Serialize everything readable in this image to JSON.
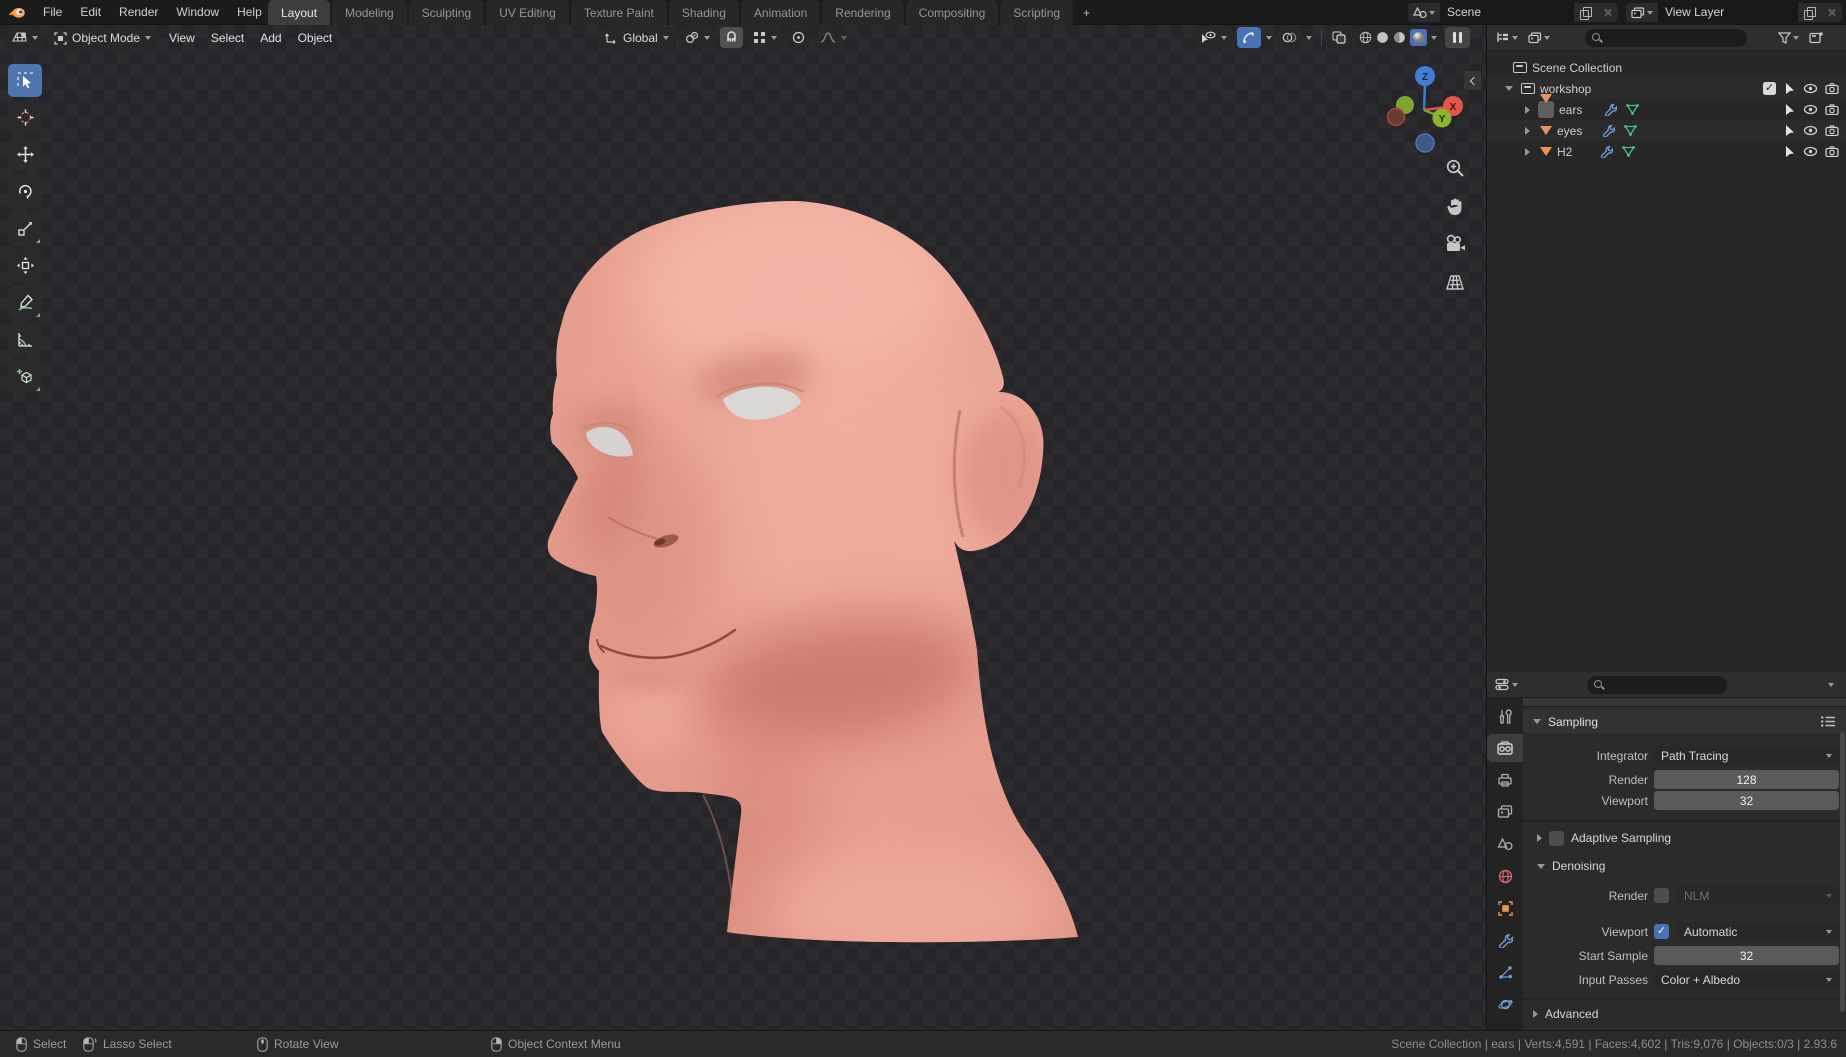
{
  "topbar": {
    "menus": [
      "File",
      "Edit",
      "Render",
      "Window",
      "Help"
    ],
    "workspaces": [
      "Layout",
      "Modeling",
      "Sculpting",
      "UV Editing",
      "Texture Paint",
      "Shading",
      "Animation",
      "Rendering",
      "Compositing",
      "Scripting"
    ],
    "active_workspace": "Layout",
    "add_workspace_label": "+",
    "scene_selector": {
      "value": "Scene"
    },
    "view_layer_selector": {
      "value": "View Layer"
    }
  },
  "viewport": {
    "header": {
      "mode": "Object Mode",
      "menus": [
        "View",
        "Select",
        "Add",
        "Object"
      ],
      "orientation": "Global"
    },
    "gizmo_axes": {
      "x": "X",
      "y": "Y",
      "z": "Z"
    }
  },
  "outliner": {
    "root_label": "Scene Collection",
    "rows": [
      {
        "label": "Scene Collection"
      },
      {
        "label": "workshop"
      },
      {
        "label": "ears"
      },
      {
        "label": "eyes"
      },
      {
        "label": "H2"
      }
    ]
  },
  "properties": {
    "sampling": {
      "title": "Sampling",
      "integrator_label": "Integrator",
      "integrator_value": "Path Tracing",
      "render_label": "Render",
      "render_value": "128",
      "viewport_label": "Viewport",
      "viewport_value": "32"
    },
    "adaptive_sampling": {
      "title": "Adaptive Sampling"
    },
    "denoising": {
      "title": "Denoising",
      "render_label": "Render",
      "render_value": "NLM",
      "viewport_label": "Viewport",
      "viewport_value": "Automatic",
      "start_sample_label": "Start Sample",
      "start_sample_value": "32",
      "input_passes_label": "Input Passes",
      "input_passes_value": "Color + Albedo"
    },
    "advanced": {
      "title": "Advanced"
    }
  },
  "statusbar": {
    "hints": [
      {
        "label": "Select"
      },
      {
        "label": "Lasso Select"
      },
      {
        "label": "Rotate View"
      },
      {
        "label": "Object Context Menu"
      }
    ],
    "stats": "Scene Collection | ears | Verts:4,591 | Faces:4,602 | Tris:9,076 | Objects:0/3 | 2.93.6"
  },
  "icons": {
    "check": "✓",
    "note": "icon glyphs rendered as CSS/SVG shapes; semantic names on data-name attributes"
  },
  "colors": {
    "accent_blue": "#4772b3",
    "skin_base": "#e79c8d",
    "skin_highlight": "#f4b7a6",
    "skin_shadow": "#c47365",
    "axis_x": "#e2574c",
    "axis_y": "#8bb32e",
    "axis_z": "#3f7dd6",
    "mesh_icon_orange": "#e8935c",
    "modifier_blue": "#6f9fd8",
    "meshdata_green": "#46c387"
  }
}
